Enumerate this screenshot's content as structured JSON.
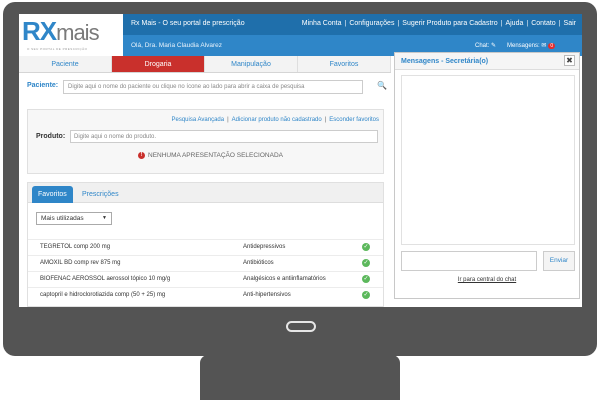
{
  "app": {
    "logo_rx": "RX",
    "logo_mais": "mais",
    "logo_tagline": "O SEU PORTAL DE PRESCRIÇÃO",
    "title": "Rx Mais - O seu portal de prescrição"
  },
  "toplinks": [
    "Minha Conta",
    "Configurações",
    "Sugerir Produto para Cadastro",
    "Ajuda",
    "Contato",
    "Sair"
  ],
  "userbar": {
    "greeting": "Olá, Dra. Maria Claudia Alvarez",
    "chat_label": "Chat:",
    "messages_label": "Mensagens:",
    "messages_count": "0"
  },
  "nav": {
    "tabs": [
      "Paciente",
      "Drogaria",
      "Manipulação",
      "Favoritos"
    ],
    "active": "Drogaria"
  },
  "paciente": {
    "label": "Paciente:",
    "placeholder": "Digite aqui o nome do paciente ou clique no ícone ao lado para abrir a caixa de pesquisa"
  },
  "produto": {
    "links": [
      "Pesquisa Avançada",
      "Adicionar produto não cadastrado",
      "Esconder favoritos"
    ],
    "label": "Produto:",
    "placeholder": "Digite aqui o nome do produto.",
    "warning": "NENHUMA APRESENTAÇÃO SELECIONADA"
  },
  "favoritos": {
    "tabs": [
      "Favoritos",
      "Prescrições"
    ],
    "select_value": "Mais utilizadas",
    "rows": [
      {
        "name": "TEGRETOL comp 200 mg",
        "category": "Antidepressivos"
      },
      {
        "name": "AMOXIL BD comp rev 875 mg",
        "category": "Antibióticos"
      },
      {
        "name": "BIOFENAC AEROSSOL aerossol tópico 10 mg/g",
        "category": "Analgésicos e antiinflamatórios"
      },
      {
        "name": "captopril e hidroclorotiazida comp (50 + 25) mg",
        "category": "Anti-hipertensivos"
      }
    ]
  },
  "chat": {
    "title": "Mensagens - Secretária(o)",
    "send_label": "Enviar",
    "central_link": "Ir para central do chat"
  },
  "colors": {
    "primary": "#2f86c8",
    "dark_primary": "#1f6fab",
    "active_tab": "#c9302c",
    "monitor": "#545454",
    "ok": "#5cb85c"
  }
}
